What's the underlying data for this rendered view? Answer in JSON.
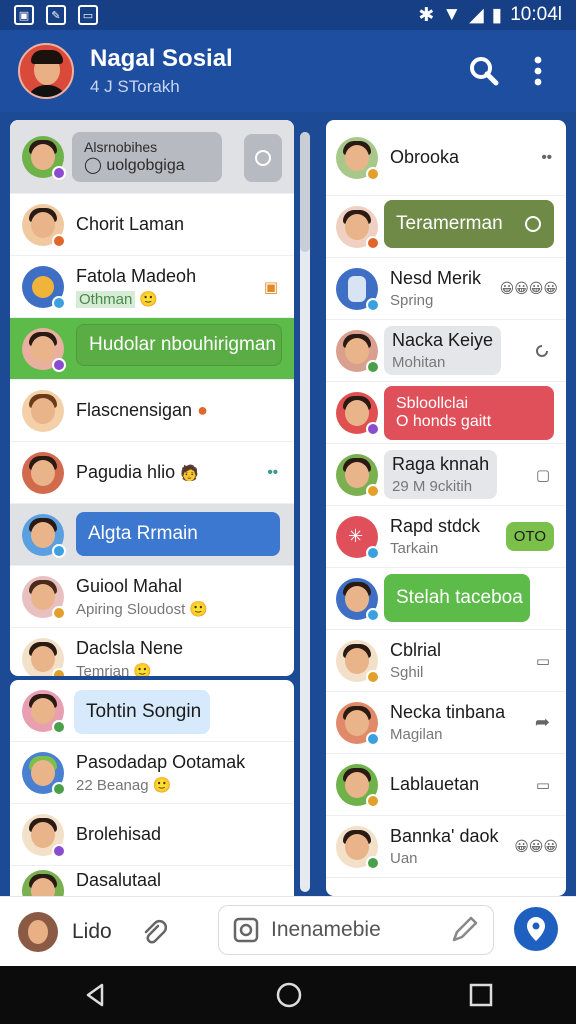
{
  "status_bar": {
    "time": "10:04l"
  },
  "header": {
    "title": "Nagal Sosial",
    "subtitle": "4 J STorakh"
  },
  "left_list": {
    "pinned_bubble_top": "Alsrnobihes",
    "pinned_bubble_bottom": "uolgobgiga",
    "items": [
      {
        "name": "Chorit Laman",
        "sub": ""
      },
      {
        "name": "Fatola Madeoh",
        "sub": "Othman",
        "emoji": "🙂"
      },
      {
        "bubble": "Hudolar nbouhirigman"
      },
      {
        "name": "Flascnensigan",
        "sub": ""
      },
      {
        "name": "Pagudia hlio",
        "sub": ""
      },
      {
        "bubble": "Algta Rrmain"
      },
      {
        "name": "Guiool Mahal",
        "sub": "Apiring Sloudost",
        "emoji": "🙂"
      },
      {
        "name": "Daclsla Nene",
        "sub": "Temrian",
        "emoji": "🙂"
      }
    ]
  },
  "left_list2": {
    "items": [
      {
        "bubble": "Tohtin Songin"
      },
      {
        "name": "Pasodadap Ootamak",
        "sub": "22 Beanag",
        "emoji": "🙂"
      },
      {
        "name": "Brolehisad",
        "sub": ""
      },
      {
        "name": "Dasalutaal",
        "sub": ""
      }
    ]
  },
  "right_list": {
    "items": [
      {
        "name": "Obrooka",
        "sub": ""
      },
      {
        "bubble": "Teramerman"
      },
      {
        "name": "Nesd Merik",
        "sub": "Spring"
      },
      {
        "name": "Nacka Keiye",
        "sub": "Mohitan"
      },
      {
        "bubble_line1": "Sbloollclai",
        "bubble_line2": "O honds gaitt"
      },
      {
        "name": "Raga knnah",
        "sub": "29 M 9ckitih"
      },
      {
        "name": "Rapd stdck",
        "sub": "Tarkain",
        "tag": "OTO"
      },
      {
        "bubble": "Stelah taceboa"
      },
      {
        "name": "Cblrial",
        "sub": "Sghil"
      },
      {
        "name": "Necka tinbana",
        "sub": "Magilan"
      },
      {
        "name": "Lablauetan",
        "sub": ""
      },
      {
        "name": "Bannka' daok",
        "sub": "Uan"
      }
    ]
  },
  "bottom_bar": {
    "label": "Lido",
    "input_placeholder": "Inenamebie"
  },
  "colors": {
    "primary": "#1e4ea0",
    "green": "#5dbb4a",
    "blue_bubble": "#3d78d0",
    "red_bubble": "#e0505a",
    "olive_bubble": "#6e8a46"
  }
}
